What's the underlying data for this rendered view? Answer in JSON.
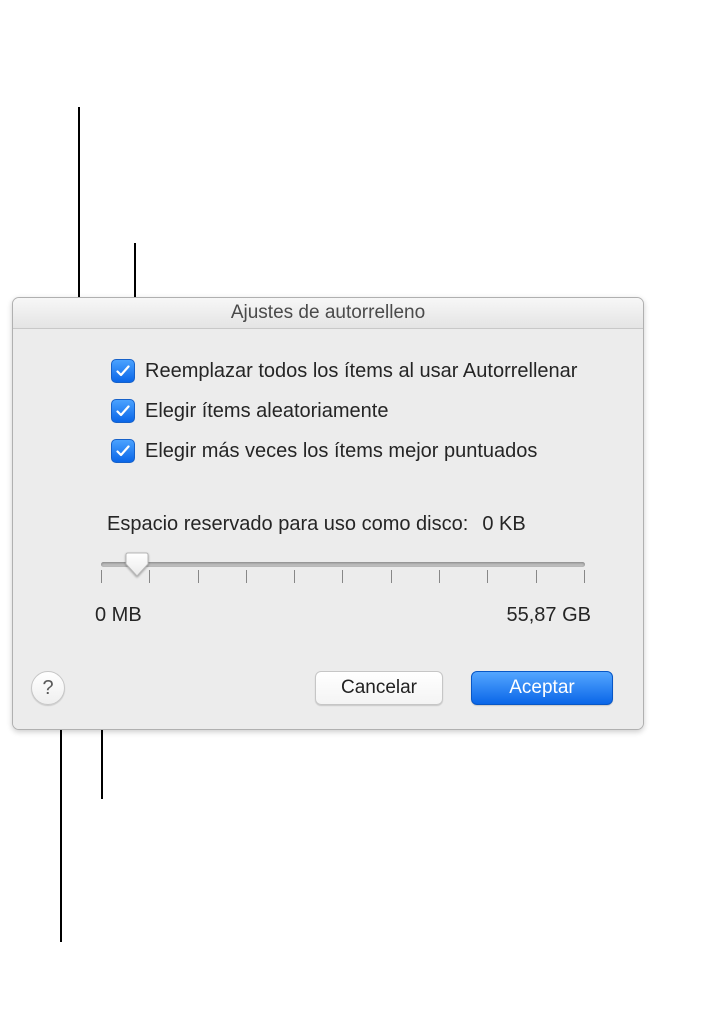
{
  "dialog": {
    "title": "Ajustes de autorrelleno",
    "checkboxes": {
      "replace_all": {
        "label": "Reemplazar todos los ítems al usar Autorrellenar",
        "checked": true
      },
      "random_items": {
        "label": "Elegir ítems aleatoriamente",
        "checked": true
      },
      "higher_rated": {
        "label": "Elegir más veces los ítems mejor puntuados",
        "checked": true
      }
    },
    "slider": {
      "label": "Espacio reservado para uso como disco:",
      "value_text": "0 KB",
      "min_text": "0 MB",
      "max_text": "55,87 GB"
    },
    "buttons": {
      "help": "?",
      "cancel": "Cancelar",
      "ok": "Aceptar"
    }
  }
}
